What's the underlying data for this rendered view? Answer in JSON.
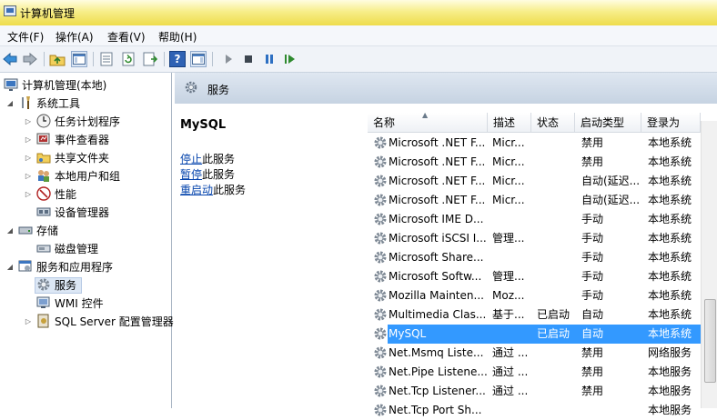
{
  "window": {
    "title": "计算机管理"
  },
  "menu": [
    "文件(F)",
    "操作(A)",
    "查看(V)",
    "帮助(H)"
  ],
  "tree": {
    "root": "计算机管理(本地)",
    "system_tools": "系统工具",
    "task_scheduler": "任务计划程序",
    "event_viewer": "事件查看器",
    "shared_folders": "共享文件夹",
    "local_users": "本地用户和组",
    "performance": "性能",
    "device_manager": "设备管理器",
    "storage": "存储",
    "disk_mgmt": "磁盘管理",
    "services_apps": "服务和应用程序",
    "services": "服务",
    "wmi": "WMI 控件",
    "sql_server": "SQL Server 配置管理器"
  },
  "panel": {
    "title": "服务"
  },
  "detail": {
    "service_name": "MySQL",
    "stop_link": "停止",
    "stop_suffix": "此服务",
    "pause_link": "暂停",
    "pause_suffix": "此服务",
    "restart_link": "重启动",
    "restart_suffix": "此服务"
  },
  "columns": [
    "名称",
    "描述",
    "状态",
    "启动类型",
    "登录为"
  ],
  "services": [
    {
      "name": "Microsoft .NET F...",
      "desc": "Micr...",
      "status": "",
      "startup": "禁用",
      "logon": "本地系统"
    },
    {
      "name": "Microsoft .NET F...",
      "desc": "Micr...",
      "status": "",
      "startup": "禁用",
      "logon": "本地系统"
    },
    {
      "name": "Microsoft .NET F...",
      "desc": "Micr...",
      "status": "",
      "startup": "自动(延迟...",
      "logon": "本地系统"
    },
    {
      "name": "Microsoft .NET F...",
      "desc": "Micr...",
      "status": "",
      "startup": "自动(延迟...",
      "logon": "本地系统"
    },
    {
      "name": "Microsoft IME D...",
      "desc": "",
      "status": "",
      "startup": "手动",
      "logon": "本地系统"
    },
    {
      "name": "Microsoft iSCSI I...",
      "desc": "管理...",
      "status": "",
      "startup": "手动",
      "logon": "本地系统"
    },
    {
      "name": "Microsoft Share...",
      "desc": "",
      "status": "",
      "startup": "手动",
      "logon": "本地系统"
    },
    {
      "name": "Microsoft Softw...",
      "desc": "管理...",
      "status": "",
      "startup": "手动",
      "logon": "本地系统"
    },
    {
      "name": "Mozilla Mainten...",
      "desc": "Moz...",
      "status": "",
      "startup": "手动",
      "logon": "本地系统"
    },
    {
      "name": "Multimedia Clas...",
      "desc": "基于...",
      "status": "已启动",
      "startup": "自动",
      "logon": "本地系统"
    },
    {
      "name": "MySQL",
      "desc": "",
      "status": "已启动",
      "startup": "自动",
      "logon": "本地系统",
      "selected": true
    },
    {
      "name": "Net.Msmq Liste...",
      "desc": "通过 ...",
      "status": "",
      "startup": "禁用",
      "logon": "网络服务"
    },
    {
      "name": "Net.Pipe Listene...",
      "desc": "通过 ...",
      "status": "",
      "startup": "禁用",
      "logon": "本地服务"
    },
    {
      "name": "Net.Tcp Listener...",
      "desc": "通过 ...",
      "status": "",
      "startup": "禁用",
      "logon": "本地服务"
    },
    {
      "name": "Net.Tcp Port Sh...",
      "desc": "",
      "status": "",
      "startup": "",
      "logon": "本地服务"
    }
  ],
  "colors": {
    "selection": "#3399ff",
    "link": "#0645ad",
    "title_bar": "#f7ee8a"
  },
  "icons": [
    "back-arrow-icon",
    "forward-arrow-icon",
    "up-folder-icon",
    "console-tree-icon",
    "export-list-icon",
    "refresh-icon",
    "properties-icon",
    "help-icon",
    "show-hide-icon",
    "play-icon",
    "stop-icon",
    "pause-icon",
    "resume-icon",
    "gear-icon"
  ]
}
